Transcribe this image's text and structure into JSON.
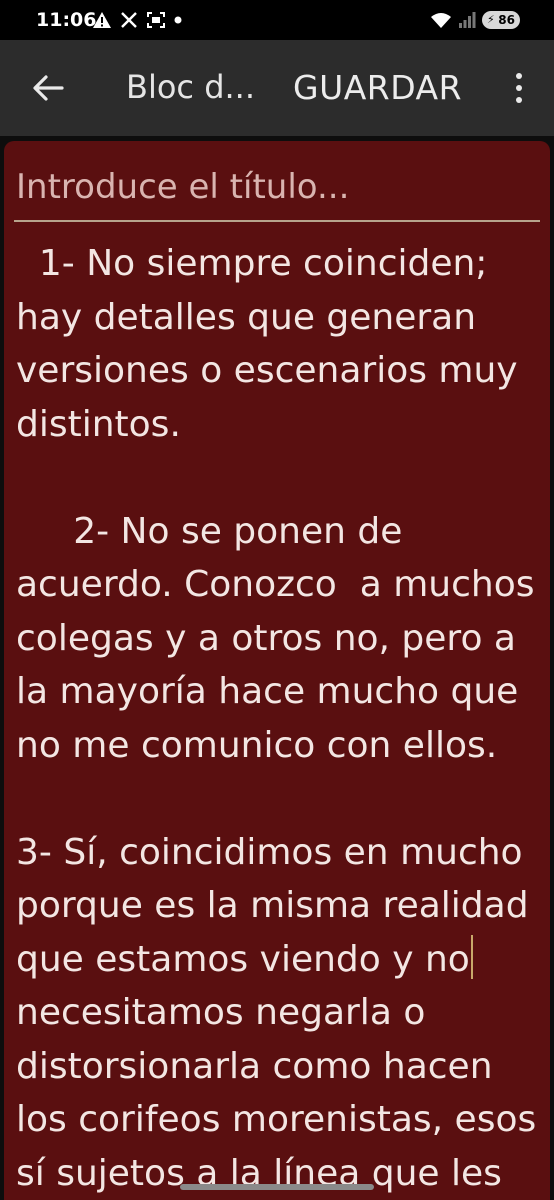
{
  "status_bar": {
    "time": "11:06",
    "left_icons": [
      "warning-icon",
      "x-icon",
      "screenshot-icon",
      "dot-icon"
    ],
    "right_icons": [
      "wifi-icon",
      "signal-icon"
    ],
    "battery_level": "86"
  },
  "toolbar": {
    "back_icon": "arrow-left-icon",
    "title": "Bloc d...",
    "save_label": "GUARDAR",
    "menu_icon": "more-vert-icon"
  },
  "editor": {
    "title_placeholder": "Introduce el título...",
    "paragraph_1": "  1- No siempre coinciden; hay detalles que generan versiones o escenarios muy distintos.",
    "paragraph_2": "     2- No se ponen de acuerdo. Conozco  a muchos colegas y a otros no, pero a la mayoría hace mucho que no me comunico con ellos.",
    "paragraph_3_before_cursor": "3- Sí, coincidimos en mucho porque es la misma realidad que estamos viendo y no",
    "paragraph_3_after_cursor": " necesitamos negarla o distorsionarla como hacen los corifeos morenistas, esos sí sujetos a la línea que les dicta Jesús Ramírez.",
    "background_color": "#5a0f10",
    "text_color": "#f3e6e3"
  }
}
